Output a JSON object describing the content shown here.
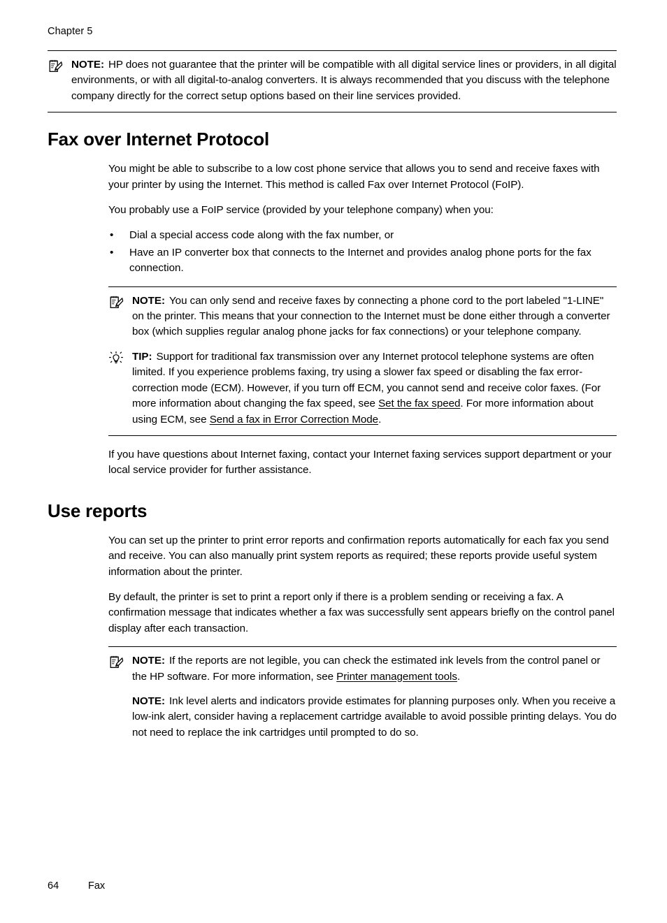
{
  "page": {
    "running_head": "Chapter 5",
    "footer": {
      "page_number": "64",
      "section_label": "Fax"
    }
  },
  "admonition_labels": {
    "note": "NOTE:",
    "tip": "TIP:"
  },
  "icons": {
    "note": "note-pad-pencil-icon",
    "tip": "light-bulb-icon"
  },
  "blocks": {
    "note_digital": {
      "label": "NOTE:",
      "icon": "note-pad-pencil-icon",
      "text": "HP does not guarantee that the printer will be compatible with all digital service lines or providers, in all digital environments, or with all digital-to-analog converters. It is always recommended that you discuss with the telephone company directly for the correct setup options based on their line services provided."
    },
    "foip": {
      "title": "Fax over Internet Protocol",
      "para1": "You might be able to subscribe to a low cost phone service that allows you to send and receive faxes with your printer by using the Internet. This method is called Fax over Internet Protocol (FoIP).",
      "para2": "You probably use a FoIP service (provided by your telephone company) when you:",
      "bullet_marker": "•",
      "bullets": [
        "Dial a special access code along with the fax number, or",
        "Have an IP converter box that connects to the Internet and provides analog phone ports for the fax connection."
      ],
      "note": {
        "label": "NOTE:",
        "icon": "note-pad-pencil-icon",
        "text": "You can only send and receive faxes by connecting a phone cord to the port labeled \"1-LINE\" on the printer. This means that your connection to the Internet must be done either through a converter box (which supplies regular analog phone jacks for fax connections) or your telephone company."
      },
      "tip": {
        "label": "TIP:",
        "icon": "light-bulb-icon",
        "text_part1": "Support for traditional fax transmission over any Internet protocol telephone systems are often limited. If you experience problems faxing, try using a slower fax speed or disabling the fax error-correction mode (ECM). However, if you turn off ECM, you cannot send and receive color faxes. (For more information about changing the fax speed, see ",
        "link1": "Set the fax speed",
        "text_part2": ". For more information about using ECM, see ",
        "link2": "Send a fax in Error Correction Mode",
        "text_part3": "."
      },
      "closing_para": "If you have questions about Internet faxing, contact your Internet faxing services support department or your local service provider for further assistance."
    },
    "use_reports": {
      "title": "Use reports",
      "para1": "You can set up the printer to print error reports and confirmation reports automatically for each fax you send and receive. You can also manually print system reports as required; these reports provide useful system information about the printer.",
      "para2": "By default, the printer is set to print a report only if there is a problem sending or receiving a fax. A confirmation message that indicates whether a fax was successfully sent appears briefly on the control panel display after each transaction.",
      "note1": {
        "label": "NOTE:",
        "icon": "note-pad-pencil-icon",
        "text_part1": "If the reports are not legible, you can check the estimated ink levels from the control panel or the HP software. For more information, see ",
        "link1": "Printer management tools",
        "text_part2": "."
      },
      "note2": {
        "label": "NOTE:",
        "text": "Ink level alerts and indicators provide estimates for planning purposes only. When you receive a low-ink alert, consider having a replacement cartridge available to avoid possible printing delays. You do not need to replace the ink cartridges until prompted to do so."
      }
    }
  }
}
